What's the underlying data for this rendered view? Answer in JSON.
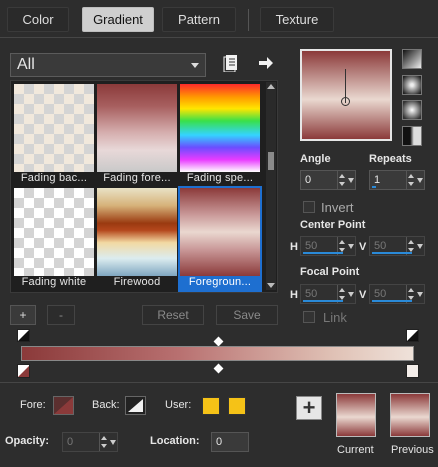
{
  "tabs": [
    {
      "label": "Color"
    },
    {
      "label": "Gradient",
      "active": true
    },
    {
      "label": "Pattern"
    },
    {
      "label": "Texture"
    }
  ],
  "category": {
    "selected": "All"
  },
  "gradients": [
    {
      "label": "Fading bac..."
    },
    {
      "label": "Fading fore..."
    },
    {
      "label": "Fading spe..."
    },
    {
      "label": "Fading white"
    },
    {
      "label": "Firewood"
    },
    {
      "label": "Foregroun...",
      "selected": true
    }
  ],
  "editor_buttons": {
    "add": "+",
    "remove": "-",
    "reset": "Reset",
    "save": "Save"
  },
  "angle": {
    "label": "Angle",
    "value": "0"
  },
  "repeats": {
    "label": "Repeats",
    "value": "1"
  },
  "invert": {
    "label": "Invert",
    "checked": false
  },
  "center_point": {
    "label": "Center Point",
    "h_label": "H",
    "h_value": "50",
    "v_label": "V",
    "v_value": "50"
  },
  "focal_point": {
    "label": "Focal Point",
    "h_label": "H",
    "h_value": "50",
    "v_label": "V",
    "v_value": "50"
  },
  "link": {
    "label": "Link",
    "checked": false
  },
  "gradient_stops": {
    "start_color": "#8b3a3a",
    "end_color": "#efe2da"
  },
  "fore": {
    "label": "Fore:",
    "color": "#8b3a3a"
  },
  "back": {
    "label": "Back:"
  },
  "user": {
    "label": "User:",
    "color": "#f5c217"
  },
  "opacity": {
    "label": "Opacity:",
    "value": "0"
  },
  "location": {
    "label": "Location:",
    "value": "0"
  },
  "current": {
    "label": "Current"
  },
  "previous": {
    "label": "Previous"
  },
  "colors": {
    "accent": "#1e6fd0",
    "background": "#2d2d2d"
  }
}
